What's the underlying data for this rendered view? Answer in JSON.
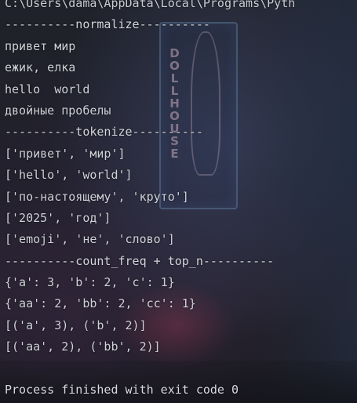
{
  "console": {
    "path_line": "C:\\Users\\dama\\AppData\\Local\\Programs\\Pyth",
    "output_lines": [
      "----------normalize----------",
      "привет мир",
      "ежик, елка",
      "hello  world",
      "двойные пробелы",
      "----------tokenize----------",
      "['привет', 'мир']",
      "['hello', 'world']",
      "['по-настоящему', 'круто']",
      "['2025', 'год']",
      "['emoji', 'не', 'слово']",
      "----------count_freq + top_n----------",
      "{'a': 3, 'b': 2, 'c': 1}",
      "{'aa': 2, 'bb': 2, 'cc': 1}",
      "[('a', 3), ('b', 2)]",
      "[('aa', 2), ('bb', 2)]"
    ],
    "exit_message": "Process finished with exit code 0"
  },
  "background": {
    "sign_letters": [
      "D",
      "O",
      "L",
      "L",
      "H",
      "O",
      "U",
      "S",
      "E"
    ]
  }
}
